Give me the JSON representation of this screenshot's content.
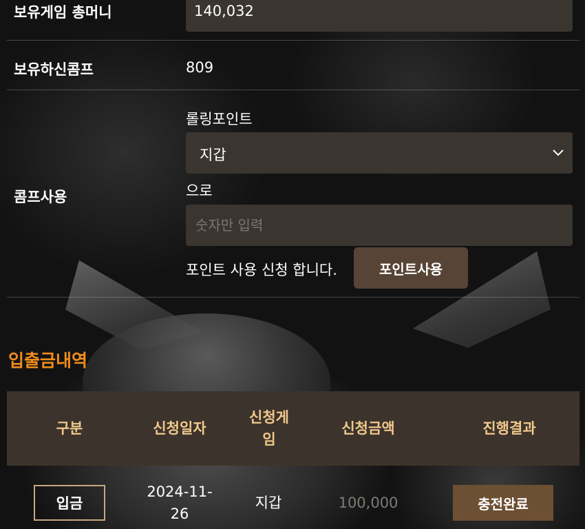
{
  "money": {
    "label": "보유게임 총머니",
    "value": "140,032"
  },
  "comp": {
    "label": "보유하신콤프",
    "value": "809"
  },
  "comp_use": {
    "label": "콤프사용",
    "rolling_label": "롤링포인트",
    "select_value": "지갑",
    "to_label": "으로",
    "input_placeholder": "숫자만 입력",
    "request_text": "포인트 사용 신청 합니다.",
    "button_label": "포인트사용"
  },
  "history": {
    "title": "입출금내역",
    "headers": [
      "구분",
      "신청일자",
      "신청게임",
      "신청금액",
      "진행결과"
    ],
    "rows": [
      {
        "type": "입금",
        "date": "2024-11-26",
        "game": "지갑",
        "amount": "100,000",
        "result": "충전완료"
      }
    ]
  },
  "colors": {
    "accent": "#f08c1c",
    "header_text": "#f1c88c",
    "panel": "#3b3530",
    "button": "#574436"
  }
}
